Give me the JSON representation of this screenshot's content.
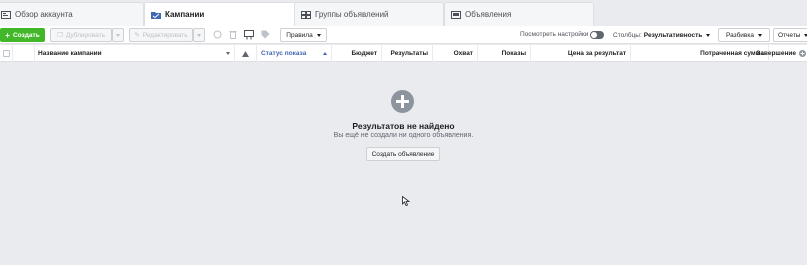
{
  "tabs": [
    {
      "label": "Обзор аккаунта",
      "icon": "account-overview-icon",
      "active": false
    },
    {
      "label": "Кампании",
      "icon": "campaigns-folder-icon",
      "active": true
    },
    {
      "label": "Группы объявлений",
      "icon": "ad-sets-grid-icon",
      "active": false
    },
    {
      "label": "Объявления",
      "icon": "ads-icon",
      "active": false
    }
  ],
  "toolbar": {
    "create_label": "Создать",
    "duplicate_label": "Дублировать",
    "edit_label": "Редактировать",
    "rules_label": "Правила",
    "view_settings_label": "Посмотреть настройки",
    "columns_label": "Столбцы:",
    "columns_value": "Результативность",
    "breakdown_label": "Разбивка",
    "reports_label": "Отчеты"
  },
  "table": {
    "columns": [
      "Название кампании",
      "Статус показа",
      "Бюджет",
      "Результаты",
      "Охват",
      "Показы",
      "Цена за результат",
      "Потраченная сумма",
      "Завершение"
    ]
  },
  "empty_state": {
    "title": "Результатов не найдено",
    "subtitle": "Вы ещё не создали ни одного объявления.",
    "button_label": "Создать объявление"
  },
  "colors": {
    "accent": "#4267b2",
    "create_green": "#42b72a",
    "background": "#e9ebee"
  }
}
